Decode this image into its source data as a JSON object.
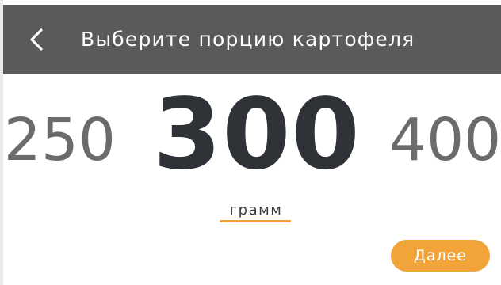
{
  "header": {
    "title": "Выберите порцию картофеля",
    "back_icon": "chevron-left-icon",
    "background": "#5a5a5a"
  },
  "picker": {
    "previous_value": "250",
    "current_value": "300",
    "next_value": "400",
    "unit": "грамм"
  },
  "actions": {
    "next_label": "Далее"
  },
  "colors": {
    "accent": "#f0a43a",
    "header": "#5a5a5a",
    "primary_text": "#2f3237",
    "secondary_text": "#6b6b6b"
  }
}
